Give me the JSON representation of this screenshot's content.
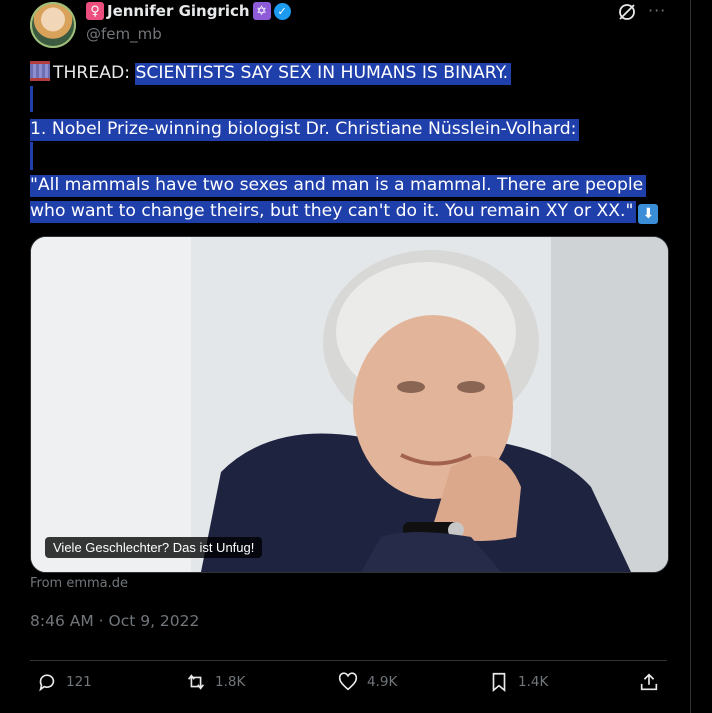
{
  "author": {
    "name": "Jennifer Gingrich",
    "female_emoji": "♀",
    "star_emoji": "✡",
    "handle": "@fem_mb"
  },
  "tweet": {
    "line1_prefix": "THREAD: ",
    "line1_highlight": "SCIENTISTS SAY SEX IN HUMANS IS BINARY.",
    "line2": "1. Nobel Prize-winning biologist Dr. Christiane Nüsslein-Volhard:",
    "line3": "\"All mammals have two sexes and man is a mammal. There are people",
    "line4": "who want to change theirs, but they can't do it. You remain XY or XX.\"",
    "down_arrow": "⬇"
  },
  "media": {
    "caption": "Viele Geschlechter? Das ist Unfug!",
    "source": "From emma.de"
  },
  "timestamp": "8:46 AM · Oct 9, 2022",
  "stats": {
    "replies": "121",
    "reposts": "1.8K",
    "likes": "4.9K",
    "bookmarks": "1.4K"
  },
  "icons": [
    "grok-icon",
    "more-icon",
    "thread-icon",
    "reply-icon",
    "repost-icon",
    "like-icon",
    "bookmark-icon",
    "share-icon"
  ],
  "colors": {
    "background": "#000000",
    "text": "#e7e9ea",
    "muted": "#71767b",
    "highlight": "#1f3faa",
    "verified": "#1d9bf0"
  }
}
